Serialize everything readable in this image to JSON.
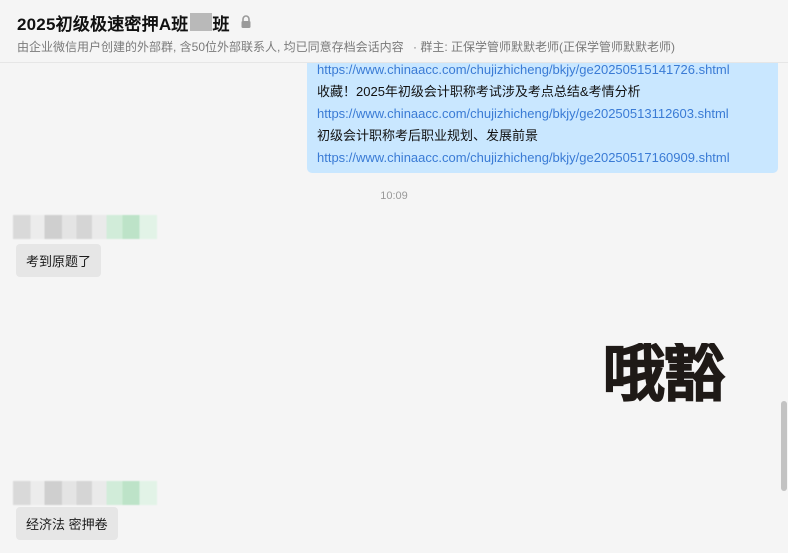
{
  "header": {
    "title_prefix": "2025初级极速密押A班",
    "title_suffix": "班",
    "subtitle": "由企业微信用户创建的外部群, 含50位外部联系人, 均已同意存档会话内容",
    "owner": "· 群主: 正保学管师默默老师(正保学管师默默老师)"
  },
  "outgoing_message": {
    "lines": [
      {
        "kind": "link",
        "text": "https://www.chinaacc.com/chujizhicheng/bkjy/ge20250515141726.shtml"
      },
      {
        "kind": "text",
        "text": "收藏！2025年初级会计职称考试涉及考点总结&考情分析"
      },
      {
        "kind": "link",
        "text": "https://www.chinaacc.com/chujizhicheng/bkjy/ge20250513112603.shtml"
      },
      {
        "kind": "text",
        "text": "初级会计职称考后职业规划、发展前景"
      },
      {
        "kind": "link",
        "text": "https://www.chinaacc.com/chujizhicheng/bkjy/ge20250517160909.shtml"
      }
    ]
  },
  "timestamp": "10:09",
  "incoming_messages": [
    {
      "text": "考到原题了"
    },
    {
      "text": "经济法 密押卷"
    }
  ],
  "sticker": {
    "text": "哦豁",
    "icon": "sticker-image"
  },
  "icons": {
    "lock": "lock-icon"
  }
}
